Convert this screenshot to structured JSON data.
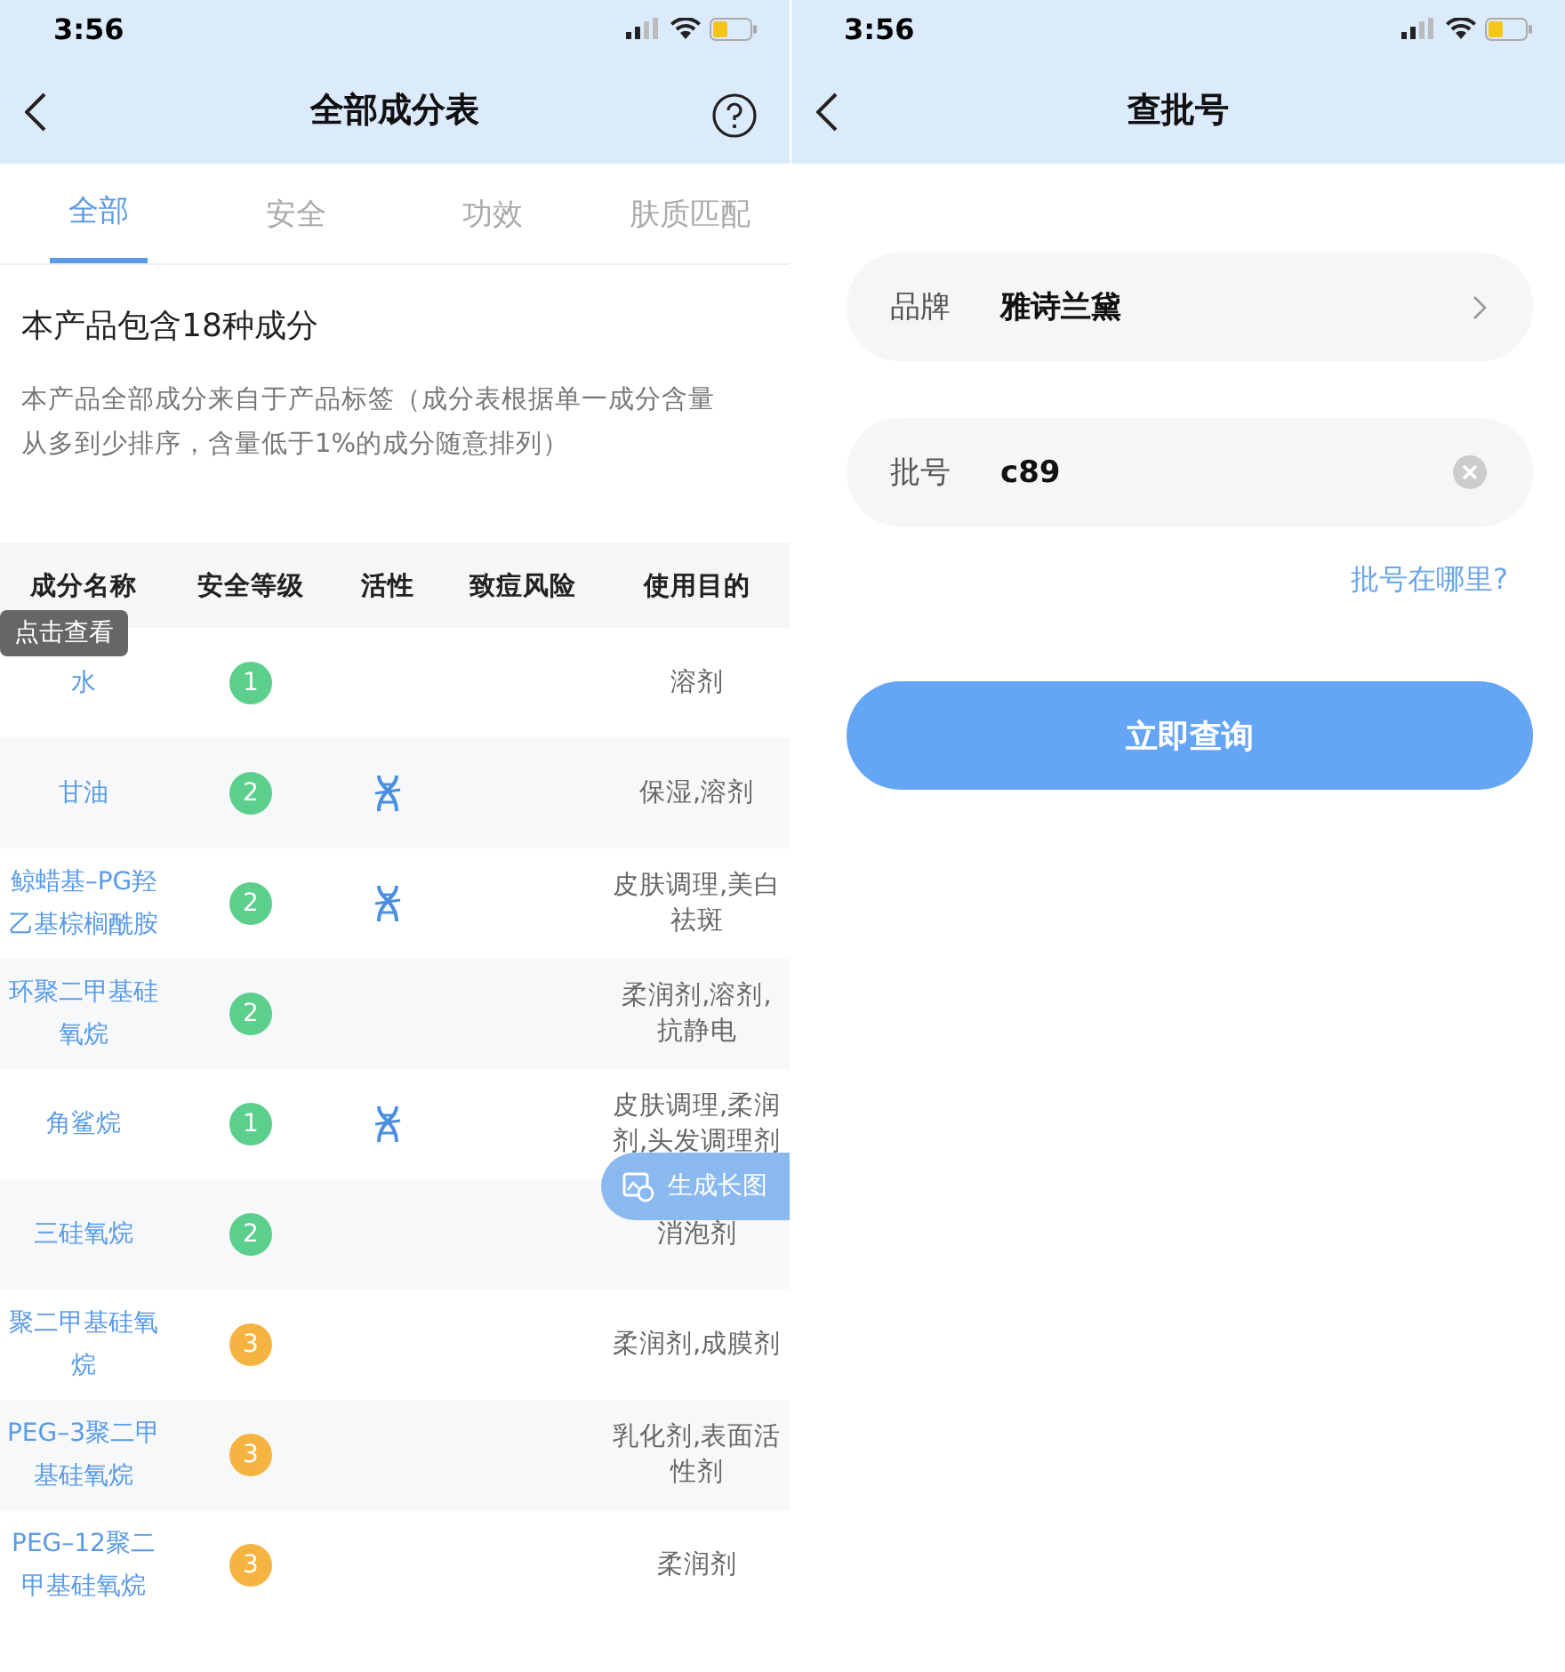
{
  "left": {
    "status_bar": {
      "time": "3:56"
    },
    "nav": {
      "title": "全部成分表"
    },
    "tabs": [
      {
        "label": "全部",
        "selected": true
      },
      {
        "label": "安全",
        "selected": false
      },
      {
        "label": "功效",
        "selected": false
      },
      {
        "label": "肤质匹配",
        "selected": false
      }
    ],
    "summary": "本产品包含18种成分",
    "description": "本产品全部成分来自于产品标签（成分表根据单一成分含量从多到少排序，含量低于1%的成分随意排列）",
    "table": {
      "columns": [
        "成分名称",
        "安全等级",
        "活性",
        "致痘风险",
        "使用目的"
      ],
      "tooltip": "点击查看",
      "rows": [
        {
          "name": "水",
          "safety": {
            "text": "1",
            "color": "#5ccf8c"
          },
          "active": false,
          "purpose": "溶剂"
        },
        {
          "name": "甘油",
          "safety": {
            "text": "2",
            "color": "#5ccf8c"
          },
          "active": true,
          "purpose": "保湿,溶剂"
        },
        {
          "name": "鲸蜡基–PG羟乙基棕榈酰胺",
          "safety": {
            "text": "2",
            "color": "#5ccf8c"
          },
          "active": true,
          "purpose": "皮肤调理,美白祛斑"
        },
        {
          "name": "环聚二甲基硅氧烷",
          "safety": {
            "text": "2",
            "color": "#5ccf8c"
          },
          "active": false,
          "purpose": "柔润剂,溶剂,抗静电"
        },
        {
          "name": "角鲨烷",
          "safety": {
            "text": "1",
            "color": "#5ccf8c"
          },
          "active": true,
          "purpose": "皮肤调理,柔润剂,头发调理剂"
        },
        {
          "name": "三硅氧烷",
          "safety": {
            "text": "2",
            "color": "#5ccf8c"
          },
          "active": false,
          "purpose": "消泡剂"
        },
        {
          "name": "聚二甲基硅氧烷",
          "safety": {
            "text": "3",
            "color": "#f5b342"
          },
          "active": false,
          "purpose": "柔润剂,成膜剂"
        },
        {
          "name": "PEG–3聚二甲基硅氧烷",
          "safety": {
            "text": "3",
            "color": "#f5b342"
          },
          "active": false,
          "purpose": "乳化剂,表面活性剂"
        },
        {
          "name": "PEG–12聚二甲基硅氧烷",
          "safety": {
            "text": "3",
            "color": "#f5b342"
          },
          "active": false,
          "purpose": "柔润剂"
        }
      ]
    },
    "float_button": "生成长图"
  },
  "right": {
    "status_bar": {
      "time": "3:56"
    },
    "nav": {
      "title": "查批号"
    },
    "fields": [
      {
        "kind": "select",
        "label": "品牌",
        "value": "雅诗兰黛"
      },
      {
        "kind": "input",
        "label": "批号",
        "value": "c89"
      }
    ],
    "help_link": "批号在哪里?",
    "submit": "立即查询"
  }
}
